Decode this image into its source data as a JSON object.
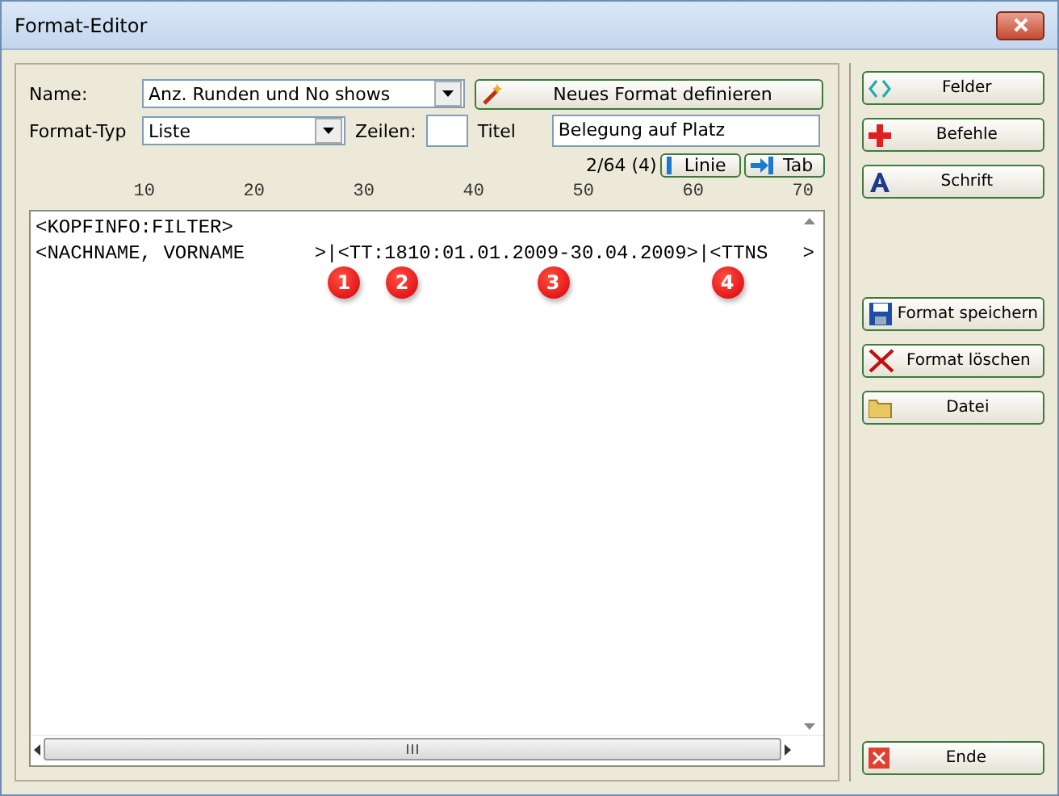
{
  "window": {
    "title": "Format-Editor"
  },
  "form": {
    "name_label": "Name:",
    "name_value": "Anz. Runden und No shows",
    "new_button": "Neues Format definieren",
    "type_label": "Format-Typ",
    "type_value": "Liste",
    "rows_label": "Zeilen:",
    "title_label": "Titel",
    "title_value": "Belegung auf Platz",
    "position": "2/64 (4)",
    "line_button": "Linie",
    "tab_button": "Tab"
  },
  "ruler": [
    "10",
    "20",
    "30",
    "40",
    "50",
    "60",
    "70"
  ],
  "editor_lines": [
    "<KOPFINFO:FILTER>",
    "<NACHNAME, VORNAME      >|<TT:1810:01.01.2009-30.04.2009>|<TTNS   >"
  ],
  "markers": [
    {
      "label": "1"
    },
    {
      "label": "2"
    },
    {
      "label": "3"
    },
    {
      "label": "4"
    }
  ],
  "side_buttons": [
    {
      "kind": "fields",
      "label": "Felder"
    },
    {
      "kind": "commands",
      "label": "Befehle"
    },
    {
      "kind": "font",
      "label": "Schrift"
    },
    {
      "kind": "save",
      "label": "Format speichern"
    },
    {
      "kind": "delete",
      "label": "Format löschen"
    },
    {
      "kind": "file",
      "label": "Datei"
    },
    {
      "kind": "end",
      "label": "Ende"
    }
  ]
}
